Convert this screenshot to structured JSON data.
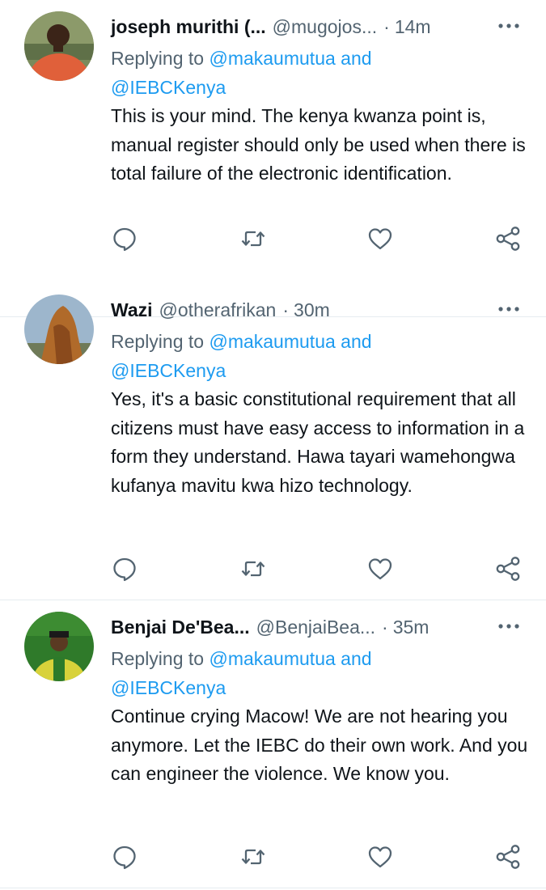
{
  "tweets": [
    {
      "name": "joseph murithi (...",
      "handle": "@mugojos...",
      "dot": "·",
      "time": "14m",
      "replying_prefix": "Replying to",
      "replying_mention_1": "@makaumutua",
      "replying_and": "and",
      "replying_mention_2": "@IEBCKenya",
      "text": "This is your mind. The kenya kwanza point is, manual register should only be used when there is total failure of the electronic identification."
    },
    {
      "name": "Wazi",
      "handle": "@otherafrikan",
      "dot": "·",
      "time": "30m",
      "replying_prefix": "Replying to",
      "replying_mention_1": "@makaumutua",
      "replying_and": "and",
      "replying_mention_2": "@IEBCKenya",
      "text": "Yes, it's a basic constitutional requirement that all citizens must have easy access to information in a form they understand. Hawa tayari wamehongwa kufanya mavitu kwa hizo technology."
    },
    {
      "name": "Benjai De'Bea...",
      "handle": "@BenjaiBea...",
      "dot": "·",
      "time": "35m",
      "replying_prefix": "Replying to",
      "replying_mention_1": "@makaumutua",
      "replying_and": "and",
      "replying_mention_2": "@IEBCKenya",
      "text": "Continue crying Macow! We are not hearing you anymore. Let the IEBC do their own work. And you can engineer the violence. We know you."
    }
  ],
  "icons": {
    "reply": "reply-icon",
    "retweet": "retweet-icon",
    "like": "heart-icon",
    "share": "share-icon",
    "more": "more-icon"
  },
  "colors": {
    "text": "#0f1419",
    "secondary": "#536471",
    "link": "#1d9bf0",
    "border": "#e6ecf0"
  }
}
